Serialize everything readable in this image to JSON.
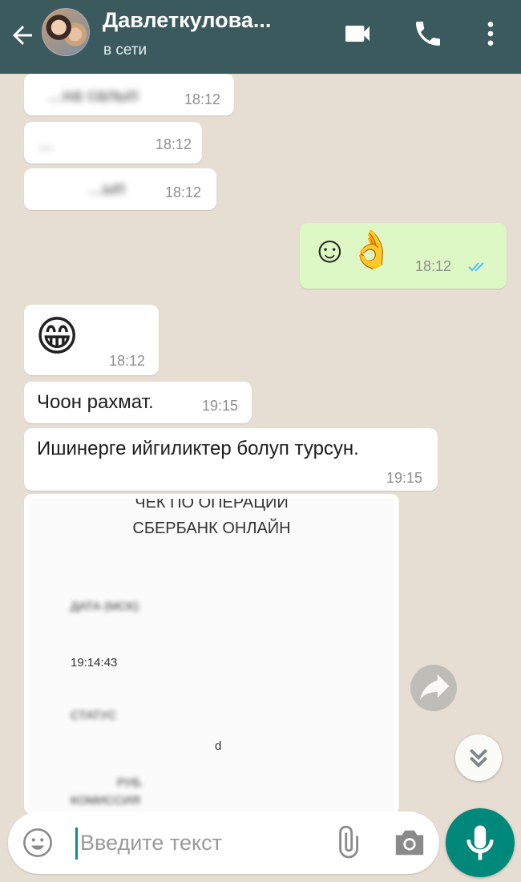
{
  "header": {
    "contact_name": "Давлеткулова...",
    "status": "в сети",
    "bg_color": "#3a5a5e"
  },
  "messages": [
    {
      "id": "m1",
      "direction": "in",
      "text": "...на салып",
      "time": "18:12",
      "obscured": true
    },
    {
      "id": "m2",
      "direction": "in",
      "text": "...",
      "time": "18:12",
      "obscured": true
    },
    {
      "id": "m3",
      "direction": "in",
      "text": "...ып",
      "time": "18:12",
      "obscured": true
    },
    {
      "id": "m4",
      "direction": "out",
      "text": "☺👌",
      "time": "18:12",
      "status": "read"
    },
    {
      "id": "m5",
      "direction": "in",
      "text": "😁",
      "time": "18:12"
    },
    {
      "id": "m6",
      "direction": "in",
      "text": "Чоон рахмат.",
      "time": "19:15"
    },
    {
      "id": "m7",
      "direction": "in",
      "text": "Ишинерге ийгиликтер болуп турсун.",
      "time": "19:15"
    }
  ],
  "receipt": {
    "title_line1": "ЧЕК ПО ОПЕРАЦИИ",
    "title_line2": "СБЕРБАНК ОНЛАЙН",
    "lines": [
      "ДАТА (МСК):",
      "19:14:43",
      "СТАТУС",
      "d",
      "РУБ.",
      "КОМИССИЯ"
    ]
  },
  "input": {
    "placeholder": "Введите текст"
  },
  "colors": {
    "chat_bg": "#e6ddd3",
    "outgoing_bubble": "#ddf7c5",
    "incoming_bubble": "#ffffff",
    "accent": "#00897b",
    "read_ticks": "#4fc3f7"
  }
}
